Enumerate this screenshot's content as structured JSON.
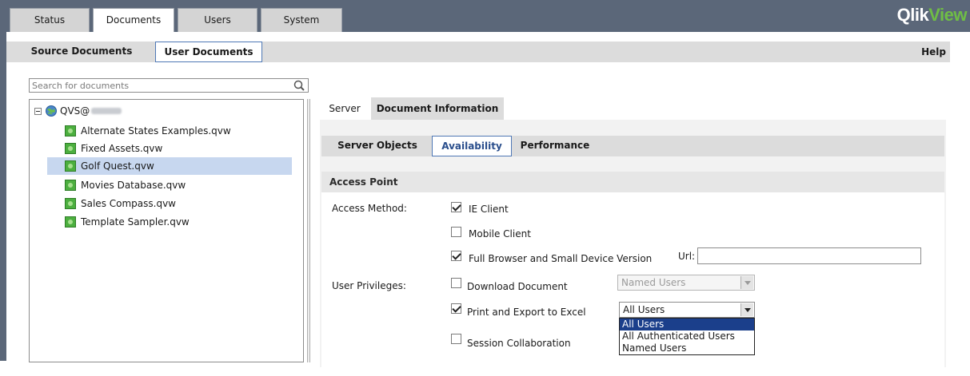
{
  "top_tabs": [
    {
      "label": "Status"
    },
    {
      "label": "Documents"
    },
    {
      "label": "Users"
    },
    {
      "label": "System"
    }
  ],
  "logo": {
    "part1": "Qlik",
    "part2": "View"
  },
  "sub_tabs": [
    {
      "label": "Source Documents"
    },
    {
      "label": "User Documents"
    }
  ],
  "help_label": "Help",
  "search": {
    "placeholder": "Search for documents"
  },
  "tree": {
    "root_label": "QVS@",
    "documents": [
      {
        "label": "Alternate States Examples.qvw"
      },
      {
        "label": "Fixed Assets.qvw"
      },
      {
        "label": "Golf Quest.qvw"
      },
      {
        "label": "Movies Database.qvw"
      },
      {
        "label": "Sales Compass.qvw"
      },
      {
        "label": "Template Sampler.qvw"
      }
    ]
  },
  "right_tabs": [
    {
      "label": "Server"
    },
    {
      "label": "Document Information"
    }
  ],
  "server_tabs": [
    {
      "label": "Server Objects"
    },
    {
      "label": "Availability"
    },
    {
      "label": "Performance"
    }
  ],
  "section_title": "Access Point",
  "access_method": {
    "label": "Access Method:",
    "ie_client": {
      "label": "IE Client",
      "checked": true
    },
    "mobile_client": {
      "label": "Mobile Client",
      "checked": false
    },
    "full_browser": {
      "label": "Full Browser and Small Device Version",
      "checked": true
    },
    "url_label": "Url:",
    "url_value": ""
  },
  "user_privileges": {
    "label": "User Privileges:",
    "download": {
      "label": "Download Document",
      "checked": false,
      "select_value": "Named Users"
    },
    "print_export": {
      "label": "Print and Export to Excel",
      "checked": true,
      "select_value": "All Users"
    },
    "session_collab": {
      "label": "Session Collaboration",
      "checked": false
    }
  },
  "dropdown_options": [
    "All Users",
    "All Authenticated Users",
    "Named Users"
  ],
  "colors": {
    "accent": "#4f78b5",
    "header": "#5b6779",
    "selected_option": "#1b3f8b",
    "logo_green": "#6fbe45"
  }
}
